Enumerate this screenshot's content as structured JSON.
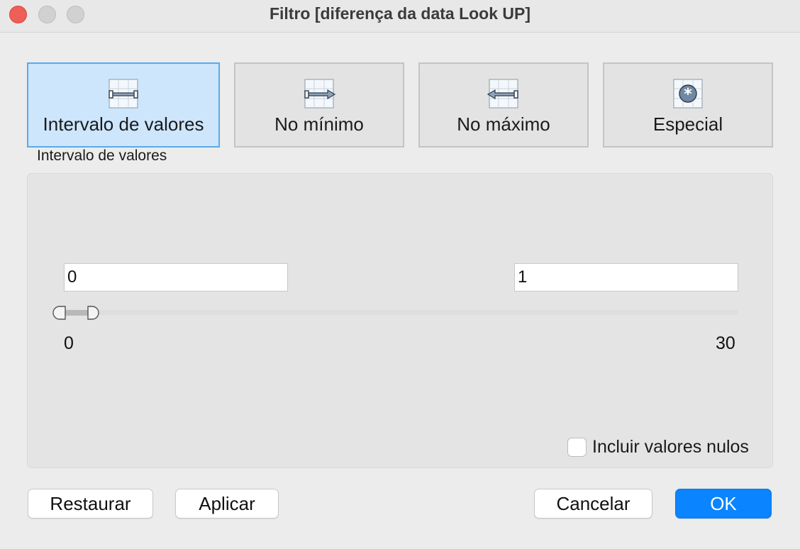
{
  "window": {
    "title": "Filtro [diferença da data Look UP]"
  },
  "modes": [
    {
      "label": "Intervalo de valores",
      "icon": "range-icon",
      "selected": true
    },
    {
      "label": "No mínimo",
      "icon": "at-least-icon",
      "selected": false
    },
    {
      "label": "No máximo",
      "icon": "at-most-icon",
      "selected": false
    },
    {
      "label": "Especial",
      "icon": "special-icon",
      "selected": false
    }
  ],
  "section_label": "Intervalo de valores",
  "range": {
    "min_value": "0",
    "max_value": "1",
    "axis_min_label": "0",
    "axis_max_label": "30"
  },
  "include_nulls": {
    "label": "Incluir valores nulos",
    "checked": false
  },
  "buttons": {
    "reset": "Restaurar",
    "apply": "Aplicar",
    "cancel": "Cancelar",
    "ok": "OK"
  },
  "colors": {
    "selected_mode_bg": "#cde6fc",
    "selected_mode_border": "#5aa9ec",
    "primary_button": "#0a84ff",
    "close_light": "#ee5f57"
  }
}
